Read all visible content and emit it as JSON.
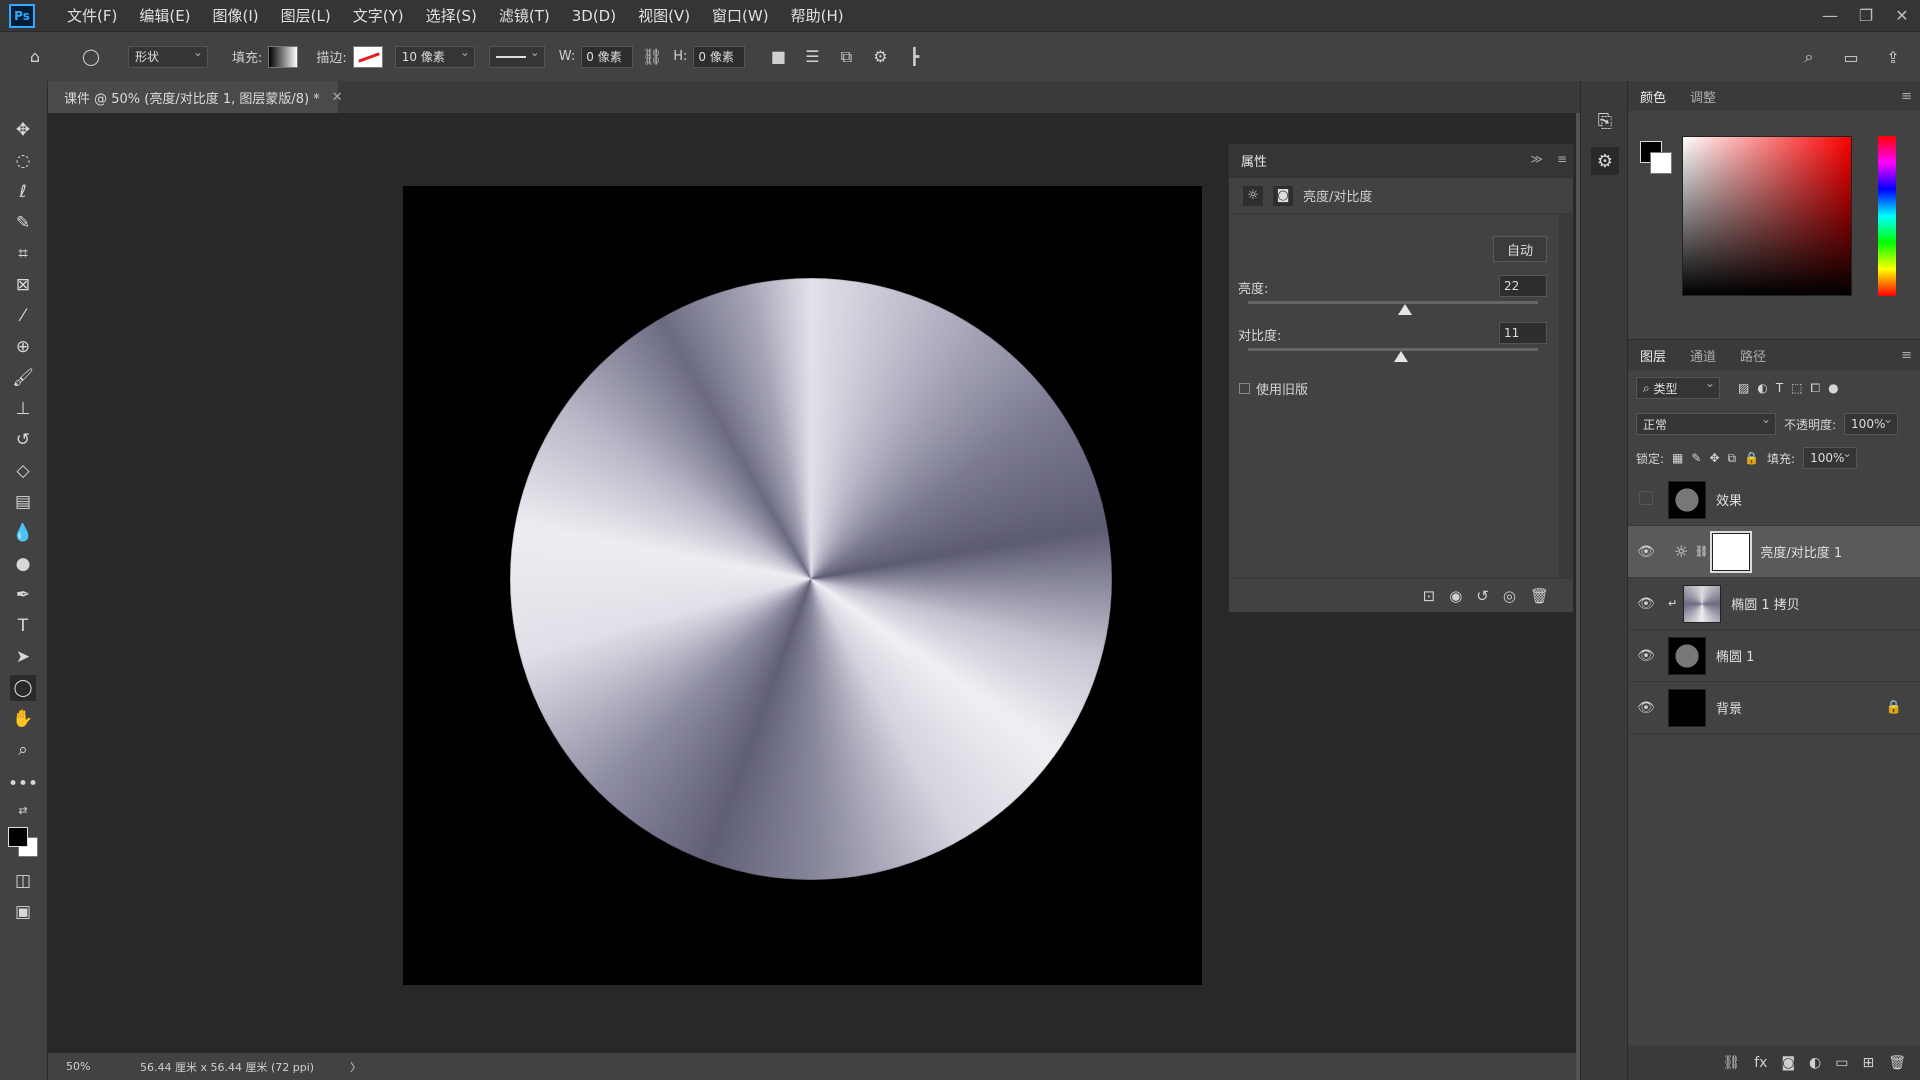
{
  "app": {
    "logo": "Ps"
  },
  "menu": [
    "文件(F)",
    "编辑(E)",
    "图像(I)",
    "图层(L)",
    "文字(Y)",
    "选择(S)",
    "滤镜(T)",
    "3D(D)",
    "视图(V)",
    "窗口(W)",
    "帮助(H)"
  ],
  "options": {
    "mode": "形状",
    "fill_label": "填充:",
    "stroke_label": "描边:",
    "stroke_width": "10 像素",
    "w_label": "W:",
    "w_value": "0 像素",
    "h_label": "H:",
    "h_value": "0 像素"
  },
  "document": {
    "tab_title": "课件 @ 50% (亮度/对比度 1, 图层蒙版/8) *"
  },
  "status": {
    "zoom": "50%",
    "doc_info": "56.44 厘米 x 56.44 厘米 (72 ppi)"
  },
  "properties": {
    "title": "属性",
    "adjustment_name": "亮度/对比度",
    "auto_button": "自动",
    "brightness_label": "亮度:",
    "brightness_value": "22",
    "brightness_level": 0.543,
    "contrast_label": "对比度:",
    "contrast_value": "11",
    "contrast_level": 0.527,
    "legacy_label": "使用旧版"
  },
  "color_panel": {
    "tabs": [
      "颜色",
      "调整"
    ],
    "foreground": "#000000",
    "background": "#ffffff"
  },
  "layers_panel": {
    "tabs": [
      "图层",
      "通道",
      "路径"
    ],
    "filter_kind": "类型",
    "blend_mode": "正常",
    "opacity_label": "不透明度:",
    "opacity_value": "100%",
    "lock_label": "锁定:",
    "fill_label": "填充:",
    "fill_value": "100%",
    "layers": [
      {
        "name": "效果",
        "visible": false
      },
      {
        "name": "亮度/对比度 1",
        "visible": true,
        "selected": true
      },
      {
        "name": "椭圆 1 拷贝",
        "visible": true
      },
      {
        "name": "椭圆 1",
        "visible": true
      },
      {
        "name": "背景",
        "visible": true,
        "locked": true
      }
    ]
  }
}
